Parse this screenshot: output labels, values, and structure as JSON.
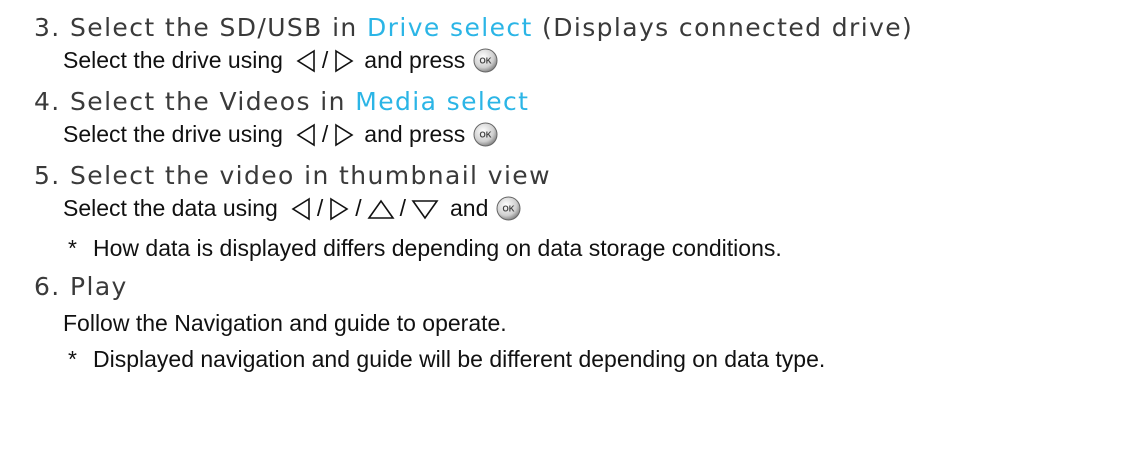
{
  "steps": [
    {
      "number": "3.",
      "pre": "Select the SD/USB in ",
      "highlight": "Drive select",
      "post": " (Displays connected drive)",
      "sub_pre": "Select the drive using",
      "sub_mid": "and press"
    },
    {
      "number": "4.",
      "pre": "Select the Videos in ",
      "highlight": "Media select",
      "post": "",
      "sub_pre": "Select the drive using",
      "sub_mid": "and press"
    },
    {
      "number": "5.",
      "text": "Select the video in thumbnail view",
      "sub_pre": "Select the data using",
      "sub_mid": "and",
      "note": "How data is displayed differs depending on data storage conditions."
    },
    {
      "number": "6.",
      "text": "Play",
      "sub_text": "Follow the Navigation and guide to operate.",
      "note": "Displayed navigation and guide will be different depending on data type."
    }
  ],
  "separator": "/",
  "note_marker": "*",
  "ok_button_label": "OK",
  "colors": {
    "highlight": "#2bb5e6",
    "heading_text": "#3a3a3a",
    "body_text": "#111111"
  },
  "icons": [
    "left-arrow-icon",
    "right-arrow-icon",
    "up-arrow-icon",
    "down-arrow-icon",
    "ok-button-icon"
  ]
}
